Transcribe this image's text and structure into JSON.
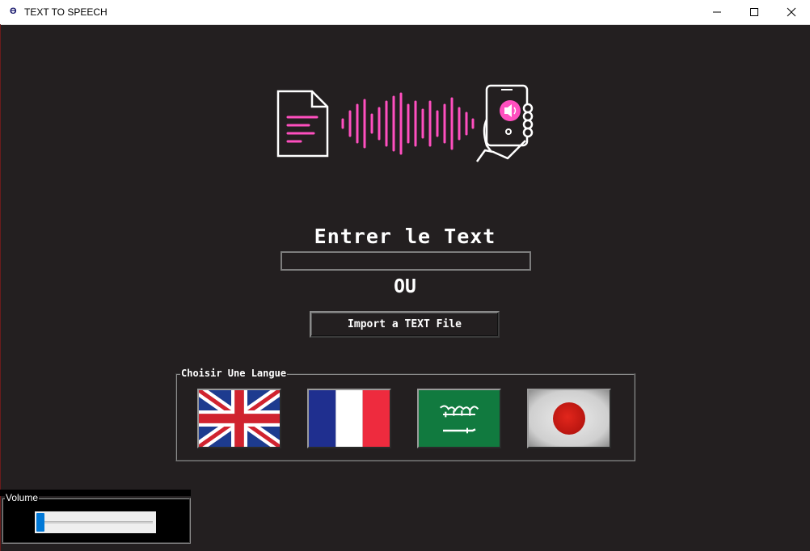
{
  "window": {
    "title": "TEXT TO SPEECH",
    "icon_glyph": "ϴ",
    "controls": [
      "minimize",
      "maximize",
      "close"
    ]
  },
  "hero": {
    "icons": [
      "document-icon",
      "sound-wave-icon",
      "phone-in-hand-speaker-icon"
    ],
    "accent_color": "#ff4fbf"
  },
  "main": {
    "heading": "Entrer le Text",
    "text_input_value": "",
    "or_label": "OU",
    "import_button": "Import a TEXT File"
  },
  "languages": {
    "legend": "Choisir Une Langue",
    "flags": [
      {
        "name": "uk-flag-icon",
        "language": "English"
      },
      {
        "name": "france-flag-icon",
        "language": "French"
      },
      {
        "name": "saudi-flag-icon",
        "language": "Arabic"
      },
      {
        "name": "japan-flag-icon",
        "language": "Japanese"
      }
    ]
  },
  "volume": {
    "legend": "Volume",
    "level": 0.0
  },
  "colors": {
    "background": "#231f20",
    "accent": "#ff4fbf",
    "slider_thumb": "#0078d7"
  }
}
